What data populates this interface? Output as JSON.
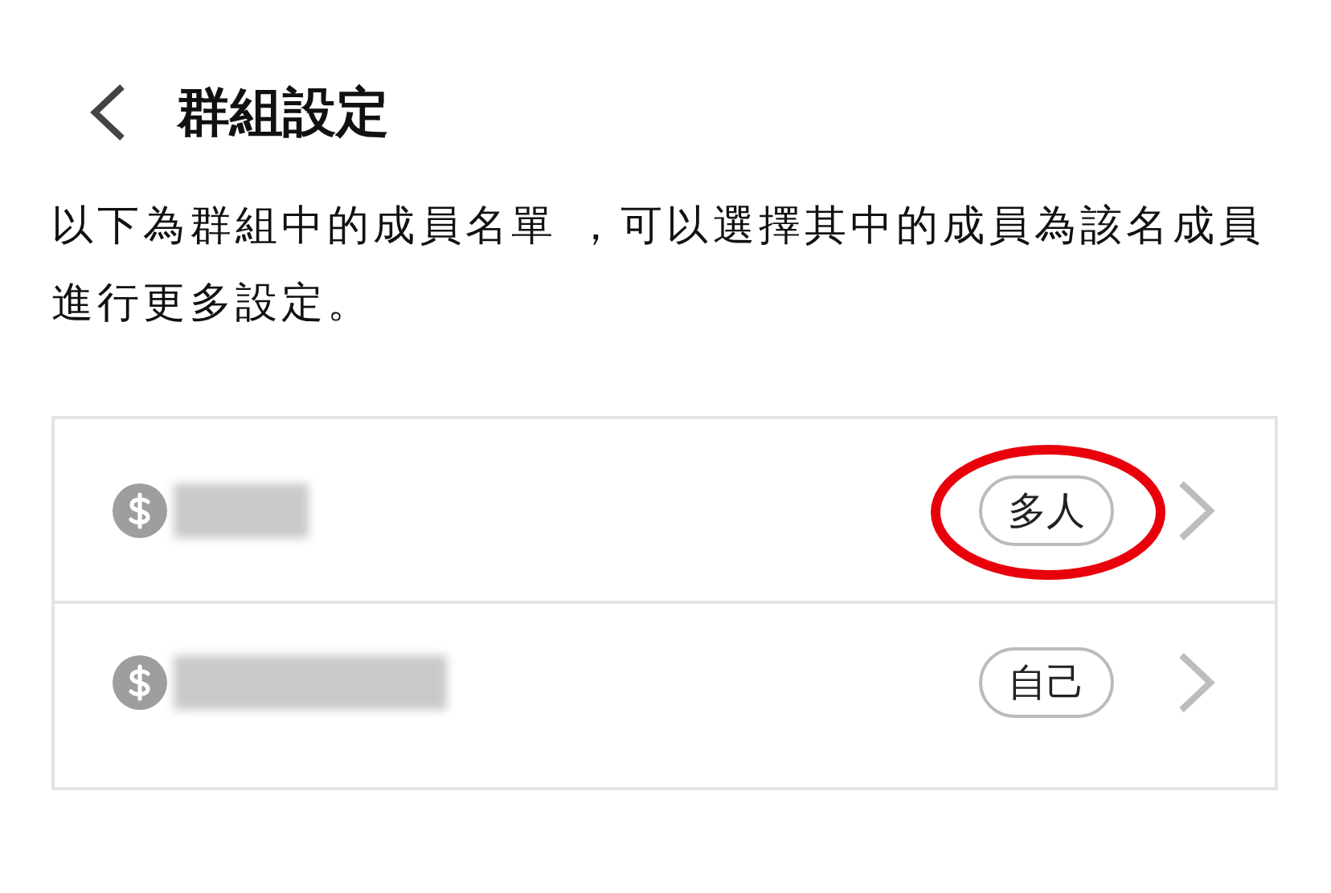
{
  "header": {
    "title": "群組設定"
  },
  "description": "以下為群組中的成員名單 ，可以選擇其中的成員為該名成員進行更多設定。",
  "members": [
    {
      "badge": "多人",
      "highlighted": true
    },
    {
      "badge": "自己",
      "highlighted": false
    }
  ]
}
